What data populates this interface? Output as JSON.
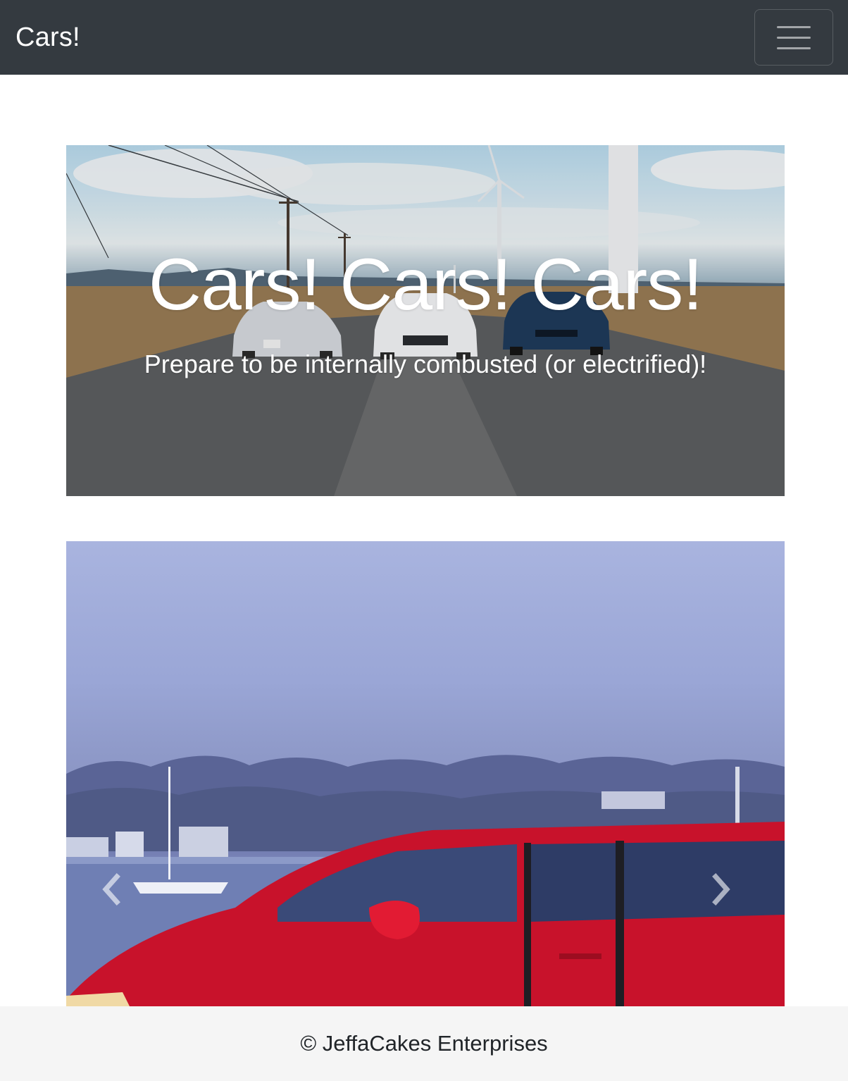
{
  "navbar": {
    "brand": "Cars!",
    "toggler_icon": "hamburger-menu-icon"
  },
  "hero": {
    "title": "Cars! Cars! Cars!",
    "subtitle": "Prepare to be internally combusted (or electrified)!"
  },
  "carousel": {
    "prev_icon": "chevron-left-icon",
    "next_icon": "chevron-right-icon"
  },
  "footer": {
    "text": "© JeffaCakes Enterprises"
  }
}
